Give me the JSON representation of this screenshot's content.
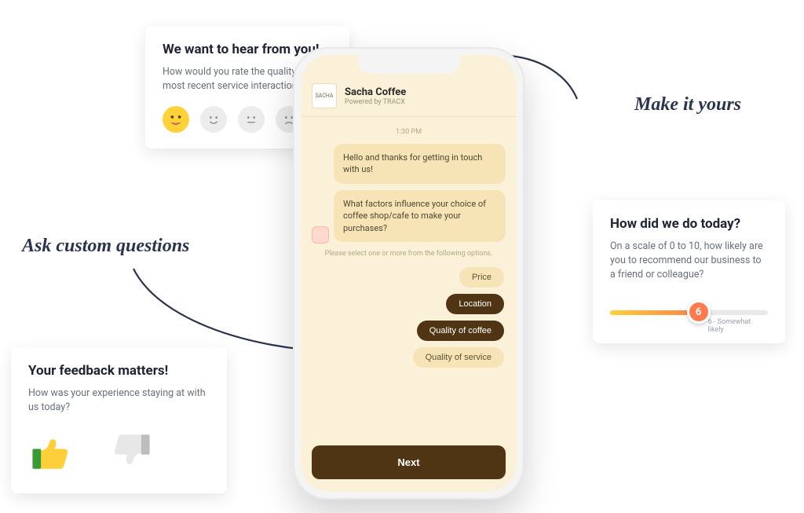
{
  "handwriting": {
    "make_it_yours": "Make it yours",
    "ask_custom": "Ask custom questions"
  },
  "card_emoji": {
    "title": "We want to hear from you!",
    "question": "How would you rate the quality of your most recent service interaction?"
  },
  "card_thumbs": {
    "title": "Your feedback matters!",
    "question": "How was your experience staying at with us today?"
  },
  "card_nps": {
    "title": "How did we do today?",
    "question": "On a scale of 0 to 10, how likely are you to recommend our business to a friend or colleague?",
    "value": "6",
    "value_label": "6 - Somewhat likely"
  },
  "phone": {
    "brand": "Sacha Coffee",
    "brand_logo_text": "SACHA",
    "powered": "Powered by TRACX",
    "time": "1:30 PM",
    "msg1": "Hello and thanks for getting in touch with us!",
    "msg2": "What factors influence your choice of coffee shop/cafe to make your purchases?",
    "hint": "Please select one or more from the following options.",
    "options": {
      "o1": "Price",
      "o2": "Location",
      "o3": "Quality of coffee",
      "o4": "Quality of service"
    },
    "next": "Next"
  }
}
